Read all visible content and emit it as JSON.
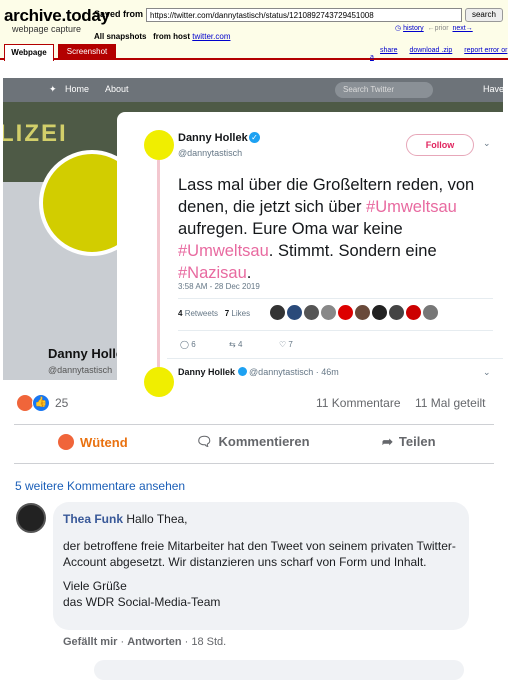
{
  "archive": {
    "logo": "archive.today",
    "subtitle": "webpage capture",
    "saved_from_label": "Saved from",
    "url": "https://twitter.com/dannytastisch/status/1210892743729451008",
    "search_button": "search",
    "snapshots_label": "All snapshots",
    "from_host_label": "from host",
    "host_link": "twitter.com",
    "history_link": "history",
    "prior_link": "←prior",
    "next_link": "next→",
    "tab_webpage": "Webpage",
    "tab_screenshot": "Screenshot",
    "share_link": "share",
    "download_link": "download .zip",
    "report_link": "report error or a"
  },
  "twitter": {
    "nav_home": "Home",
    "nav_about": "About",
    "search_placeholder": "Search Twitter",
    "nav_have": "Have",
    "banner_text": "LIZEI",
    "profile_name": "Danny Holle",
    "profile_handle": "@dannytastisch",
    "tweet": {
      "name": "Danny Hollek",
      "verified_icon": "✓",
      "handle": "@dannytastisch",
      "follow_label": "Follow",
      "text_1": "Lass mal über die Großeltern reden, von denen, die jetzt sich über ",
      "tag_1": "#Umweltsau",
      "text_2": " aufregen. Eure Oma war keine ",
      "tag_2": "#Umweltsau",
      "text_3": ". Stimmt. Sondern eine ",
      "tag_3": "#Nazisau",
      "text_4": ".",
      "timestamp": "3:58 AM - 28 Dec 2019",
      "retweets_count": "4",
      "retweets_label": "Retweets",
      "likes_count": "7",
      "likes_label": "Likes",
      "reply_count": "6",
      "retweet_count": "4",
      "like_count": "7",
      "reply_name": "Danny Hollek",
      "reply_handle": "@dannytastisch",
      "reply_time": "· 46m"
    }
  },
  "facebook": {
    "reaction_count": "25",
    "comments": "11 Kommentare",
    "shares": "11 Mal geteilt",
    "btn_angry": "Wütend",
    "btn_comment": "Kommentieren",
    "btn_share": "Teilen",
    "more_comments": "5 weitere Kommentare ansehen",
    "comment": {
      "author": "Thea Funk",
      "greeting": "Hallo Thea,",
      "paragraph": "der betroffene freie Mitarbeiter hat den Tweet von seinem privaten Twitter-Account abgesetzt. Wir distanzieren uns scharf von Form und Inhalt.",
      "closing_1": "Viele Grüße",
      "closing_2": "das WDR Social-Media-Team",
      "like_label": "Gefällt mir",
      "reply_label": "Antworten",
      "age": "18 Std."
    }
  }
}
